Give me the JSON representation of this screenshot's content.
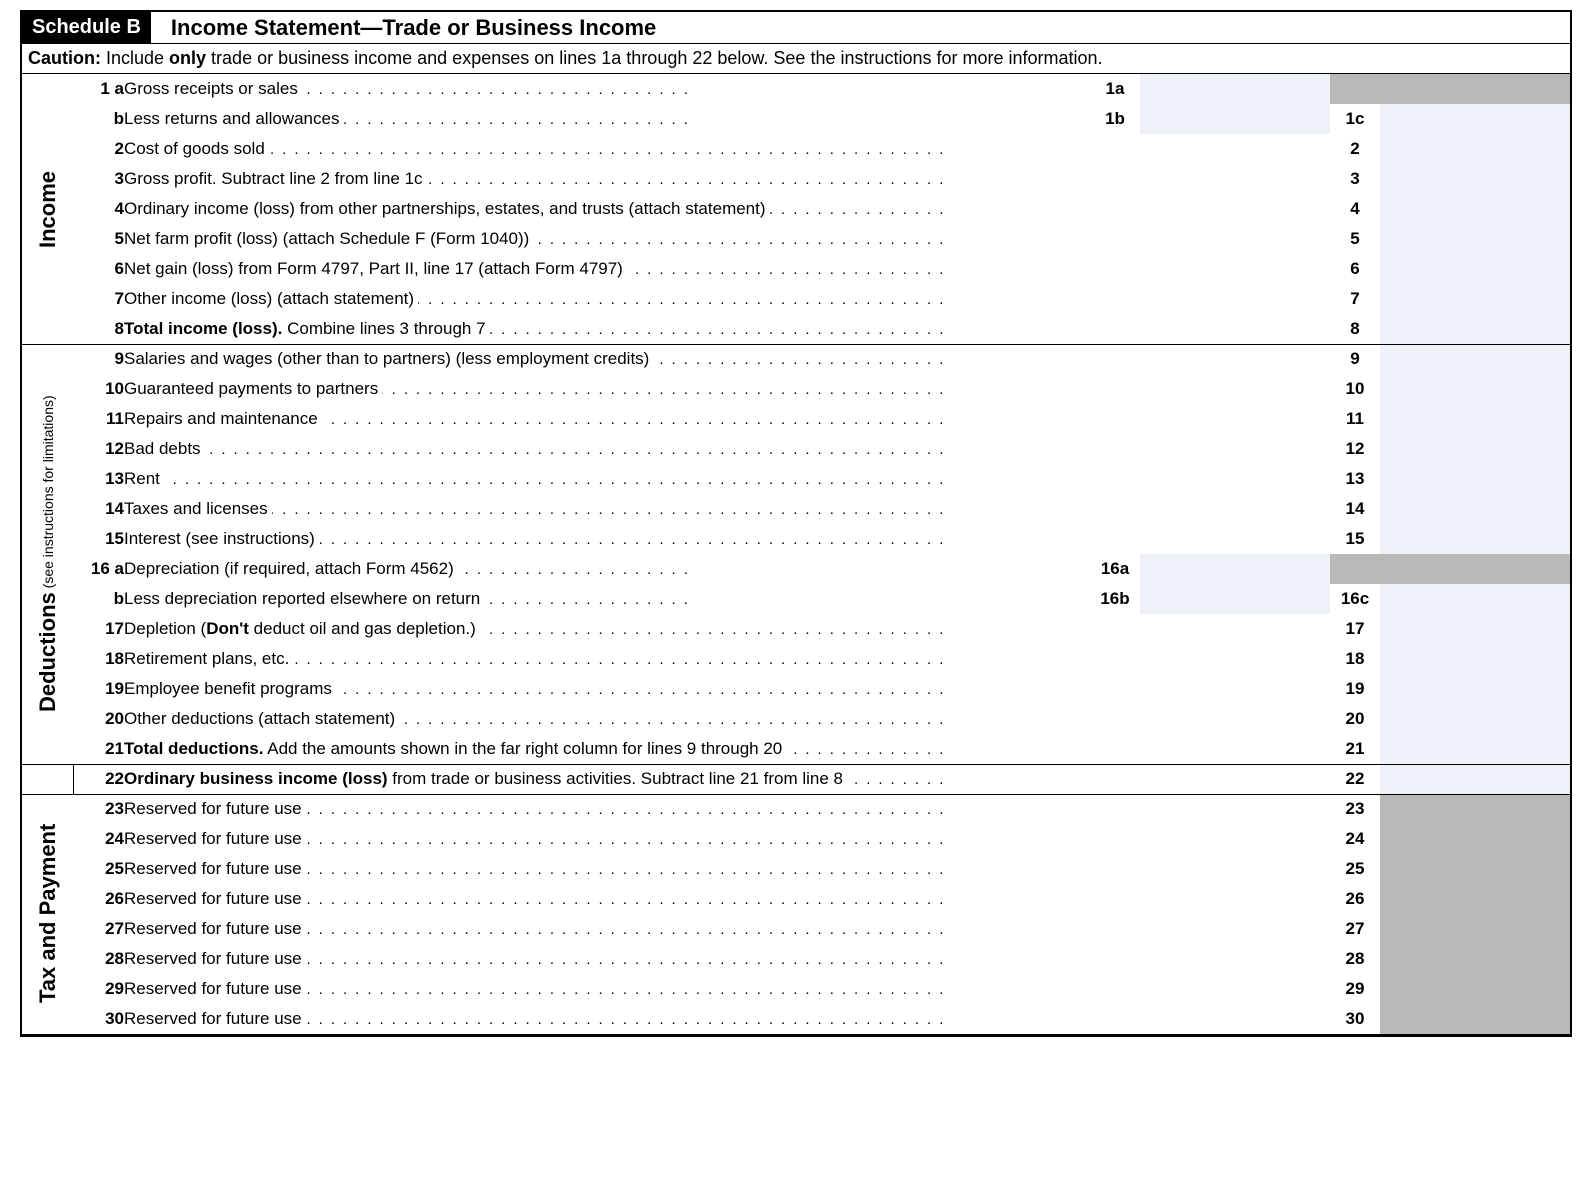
{
  "header": {
    "schedule": "Schedule B",
    "title": "Income Statement—Trade or Business Income"
  },
  "caution": {
    "label": "Caution:",
    "text_prefix": " Include ",
    "only": "only",
    "text_suffix": " trade or business income and expenses on lines 1a through 22 below. See the instructions for more information."
  },
  "sections": {
    "income": "Income",
    "deductions": "Deductions",
    "deductions_sub": " (see instructions for limitations)",
    "tax": "Tax and Payment"
  },
  "lines": {
    "l1a": {
      "num": "1 a",
      "desc": "Gross receipts or sales",
      "box": "1a"
    },
    "l1b": {
      "num": "b",
      "desc": "Less returns and allowances",
      "box": "1b",
      "rbox": "1c"
    },
    "l2": {
      "num": "2",
      "desc": "Cost of goods sold",
      "rbox": "2"
    },
    "l3": {
      "num": "3",
      "desc": "Gross profit. Subtract line 2 from line 1c",
      "rbox": "3"
    },
    "l4": {
      "num": "4",
      "desc": "Ordinary income (loss) from other partnerships, estates, and trusts (attach statement)",
      "rbox": "4"
    },
    "l5": {
      "num": "5",
      "desc": "Net farm profit (loss) (attach Schedule F (Form 1040))",
      "rbox": "5"
    },
    "l6": {
      "num": "6",
      "desc": "Net gain (loss) from Form 4797, Part II, line 17 (attach Form 4797)",
      "rbox": "6"
    },
    "l7": {
      "num": "7",
      "desc": "Other income (loss) (attach statement)",
      "rbox": "7"
    },
    "l8": {
      "num": "8",
      "desc_bold": "Total income (loss).",
      "desc_rest": " Combine lines 3 through 7",
      "rbox": "8"
    },
    "l9": {
      "num": "9",
      "desc": "Salaries and wages (other than to partners) (less employment credits)",
      "rbox": "9"
    },
    "l10": {
      "num": "10",
      "desc": "Guaranteed payments to partners",
      "rbox": "10"
    },
    "l11": {
      "num": "11",
      "desc": "Repairs and maintenance",
      "rbox": "11"
    },
    "l12": {
      "num": "12",
      "desc": "Bad debts",
      "rbox": "12"
    },
    "l13": {
      "num": "13",
      "desc": "Rent",
      "rbox": "13"
    },
    "l14": {
      "num": "14",
      "desc": "Taxes and licenses",
      "rbox": "14"
    },
    "l15": {
      "num": "15",
      "desc": "Interest (see instructions)",
      "rbox": "15"
    },
    "l16a": {
      "num": "16 a",
      "desc": "Depreciation (if required, attach Form 4562)",
      "box": "16a"
    },
    "l16b": {
      "num": "b",
      "desc": "Less depreciation reported elsewhere on return",
      "box": "16b",
      "rbox": "16c"
    },
    "l17": {
      "num": "17",
      "desc_pre": "Depletion (",
      "desc_bold": "Don't",
      "desc_post": " deduct oil and gas depletion.)",
      "rbox": "17"
    },
    "l18": {
      "num": "18",
      "desc": "Retirement plans, etc.",
      "rbox": "18"
    },
    "l19": {
      "num": "19",
      "desc": "Employee benefit programs",
      "rbox": "19"
    },
    "l20": {
      "num": "20",
      "desc": "Other deductions (attach statement)",
      "rbox": "20"
    },
    "l21": {
      "num": "21",
      "desc_bold": "Total deductions.",
      "desc_rest": " Add the amounts shown in the far right column for lines 9 through 20",
      "rbox": "21"
    },
    "l22": {
      "num": "22",
      "desc_bold": "Ordinary business income (loss)",
      "desc_rest": " from trade or business activities. Subtract line 21 from line 8",
      "rbox": "22"
    },
    "l23": {
      "num": "23",
      "desc": "Reserved for future use",
      "rbox": "23"
    },
    "l24": {
      "num": "24",
      "desc": "Reserved for future use",
      "rbox": "24"
    },
    "l25": {
      "num": "25",
      "desc": "Reserved for future use",
      "rbox": "25"
    },
    "l26": {
      "num": "26",
      "desc": "Reserved for future use",
      "rbox": "26"
    },
    "l27": {
      "num": "27",
      "desc": "Reserved for future use",
      "rbox": "27"
    },
    "l28": {
      "num": "28",
      "desc": "Reserved for future use",
      "rbox": "28"
    },
    "l29": {
      "num": "29",
      "desc": "Reserved for future use",
      "rbox": "29"
    },
    "l30": {
      "num": "30",
      "desc": "Reserved for future use",
      "rbox": "30"
    }
  }
}
